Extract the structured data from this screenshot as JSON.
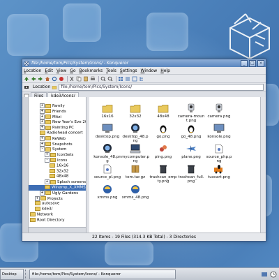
{
  "window": {
    "title": "file:/home/tom/Pics/System/Icons/ - Konqueror"
  },
  "menu": [
    {
      "pre": "",
      "u": "L",
      "post": "ocation"
    },
    {
      "pre": "",
      "u": "E",
      "post": "dit"
    },
    {
      "pre": "",
      "u": "V",
      "post": "iew"
    },
    {
      "pre": "",
      "u": "G",
      "post": "o"
    },
    {
      "pre": "",
      "u": "B",
      "post": "ookmarks"
    },
    {
      "pre": "",
      "u": "T",
      "post": "ools"
    },
    {
      "pre": "",
      "u": "S",
      "post": "ettings"
    },
    {
      "pre": "",
      "u": "W",
      "post": "indow"
    },
    {
      "pre": "",
      "u": "H",
      "post": "elp"
    }
  ],
  "location": {
    "label": "Location",
    "value": "file:/home/tom/Pics/System/Icons/"
  },
  "tabs": [
    {
      "label": "Files"
    },
    {
      "label": "kde3/Icons/"
    }
  ],
  "tree": [
    {
      "label": "Family",
      "indent": 1,
      "exp": "+"
    },
    {
      "label": "Friends",
      "indent": 1,
      "exp": "+"
    },
    {
      "label": "Mitzi",
      "indent": 1,
      "exp": "+"
    },
    {
      "label": "New Year's Eve 2001",
      "indent": 1,
      "exp": "+"
    },
    {
      "label": "Painting PC",
      "indent": 1,
      "exp": "+"
    },
    {
      "label": "Radiohead concert",
      "indent": 1,
      "exp": ""
    },
    {
      "label": "ReWeb",
      "indent": 1,
      "exp": "+"
    },
    {
      "label": "Snapshots",
      "indent": 1,
      "exp": "+"
    },
    {
      "label": "System",
      "indent": 1,
      "exp": "-"
    },
    {
      "label": "IconSets",
      "indent": 2,
      "exp": "+"
    },
    {
      "label": "Icons",
      "indent": 2,
      "exp": "-"
    },
    {
      "label": "16x16",
      "indent": 3,
      "exp": ""
    },
    {
      "label": "32x32",
      "indent": 3,
      "exp": ""
    },
    {
      "label": "48x48",
      "indent": 3,
      "exp": ""
    },
    {
      "label": "Splash screens",
      "indent": 2,
      "exp": "+"
    },
    {
      "label": "Winamp_X_XMMS_",
      "indent": 2,
      "exp": "",
      "selected": true
    },
    {
      "label": "Ugly Gardens",
      "indent": 1,
      "exp": "+"
    },
    {
      "label": "Projects",
      "indent": 0,
      "exp": "+"
    },
    {
      "label": "autosave",
      "indent": 0,
      "exp": ""
    },
    {
      "label": "kde3/",
      "indent": 0,
      "exp": ""
    },
    {
      "label": "Network",
      "indent": -1,
      "exp": ""
    },
    {
      "label": "Root Directory",
      "indent": -1,
      "exp": ""
    }
  ],
  "icons": [
    {
      "label": "16x16",
      "type": "folder"
    },
    {
      "label": "32x32",
      "type": "folder"
    },
    {
      "label": "48x48",
      "type": "folder"
    },
    {
      "label": "camera-mount.png",
      "type": "camera"
    },
    {
      "label": "camera.png",
      "type": "camera"
    },
    {
      "label": "desktop.png",
      "type": "monitor"
    },
    {
      "label": "desktop_48.png",
      "type": "monitor-dark"
    },
    {
      "label": "go.png",
      "type": "tux"
    },
    {
      "label": "go_48.png",
      "type": "tux"
    },
    {
      "label": "konsole.png",
      "type": "monitor"
    },
    {
      "label": "konsole_48.png",
      "type": "monitor-dark"
    },
    {
      "label": "mycomputer.png",
      "type": "computer"
    },
    {
      "label": "ping.png",
      "type": "ping"
    },
    {
      "label": "plane.png",
      "type": "plane"
    },
    {
      "label": "source_php.png",
      "type": "doc"
    },
    {
      "label": "source_pl.png",
      "type": "doc"
    },
    {
      "label": "tom.tar.gz",
      "type": "archive"
    },
    {
      "label": "trashcan_empty.png",
      "type": "trash"
    },
    {
      "label": "trashcan_full.png",
      "type": "trash"
    },
    {
      "label": "tuxcart.png",
      "type": "tuxcart"
    },
    {
      "label": "xmms.png",
      "type": "xmms"
    },
    {
      "label": "xmms_48.png",
      "type": "xmms"
    }
  ],
  "status": {
    "text": "22 Items - 19 Files (314.3 KB Total) - 3 Directories"
  },
  "taskbar": {
    "desktop_label": "Desktop",
    "task_label": "file:/home/tom/Pics/System/Icons/ - Konqueror"
  },
  "colors": {
    "selection": "#3d6db4",
    "titlebar": "#5a86bf",
    "desktop": "#4a7fb9"
  }
}
